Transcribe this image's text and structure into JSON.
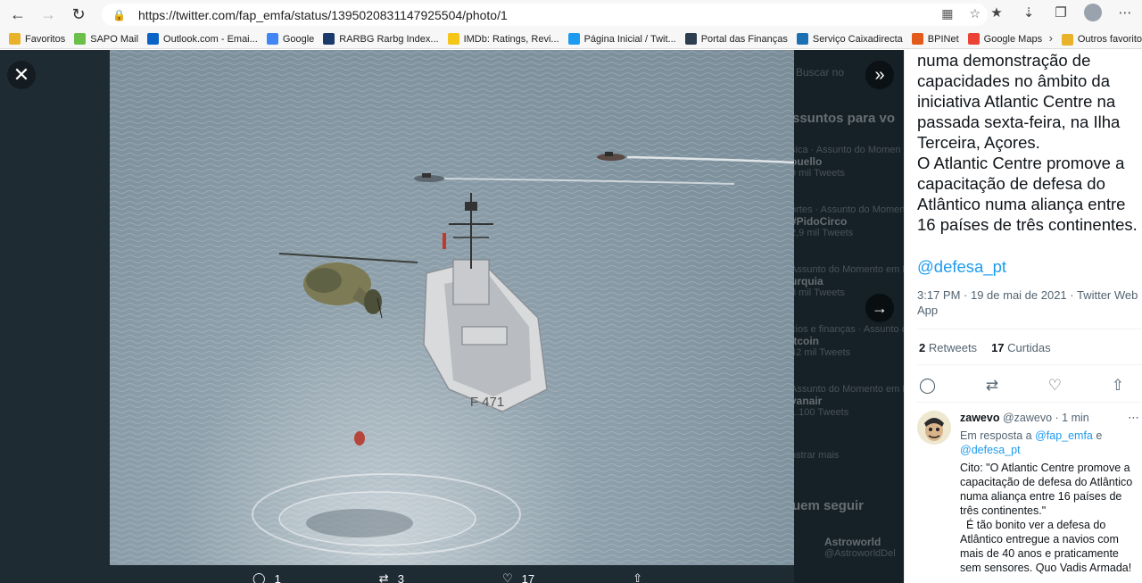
{
  "browser": {
    "url": "https://twitter.com/fap_emfa/status/1395020831147925504/photo/1",
    "bookmarks": [
      {
        "label": "Favoritos",
        "icon": "folder-icon",
        "color": "#e8b32a"
      },
      {
        "label": "SAPO Mail",
        "icon": "sapo-icon",
        "color": "#6cc04a"
      },
      {
        "label": "Outlook.com - Emai...",
        "icon": "outlook-icon",
        "color": "#0a64c8"
      },
      {
        "label": "Google",
        "icon": "google-icon",
        "color": "#4285f4"
      },
      {
        "label": "RARBG Rarbg Index...",
        "icon": "rarbg-icon",
        "color": "#1b3a6b"
      },
      {
        "label": "IMDb: Ratings, Revi...",
        "icon": "imdb-icon",
        "color": "#f5c518"
      },
      {
        "label": "Página Inicial / Twit...",
        "icon": "twitter-icon",
        "color": "#1d9bf0"
      },
      {
        "label": "Portal das Finanças",
        "icon": "financas-icon",
        "color": "#2c3e50"
      },
      {
        "label": "Serviço Caixadirecta",
        "icon": "caixa-icon",
        "color": "#1b6fb3"
      },
      {
        "label": "BPINet",
        "icon": "bpi-icon",
        "color": "#e35a1b"
      },
      {
        "label": "Google Maps",
        "icon": "maps-icon",
        "color": "#ea4335"
      }
    ],
    "other_favorites": "Outros favorito"
  },
  "tweet": {
    "text_lines": [
      "numa demonstração de",
      "capacidades no âmbito da",
      "iniciativa Atlantic Centre na",
      "passada sexta-feira, na Ilha",
      "Terceira, Açores.",
      "O Atlantic Centre promove a",
      "capacitação de defesa do",
      "Atlântico numa aliança entre",
      "16 países de três continentes."
    ],
    "mention": "@defesa_pt",
    "timestamp": "3:17 PM · 19 de mai de 2021 · Twitter Web App",
    "retweets_count": "2",
    "retweets_label": "Retweets",
    "likes_count": "17",
    "likes_label": "Curtidas"
  },
  "media_actions": {
    "replies": "1",
    "retweets": "3",
    "likes": "17"
  },
  "ship_marking": "F 471",
  "ghost": {
    "search": "Buscar no",
    "trends_title": "ssuntos para vo",
    "trends": [
      {
        "meta": "sica · Assunto do Momen",
        "name": "ouello",
        "count": "9 mil Tweets"
      },
      {
        "meta": "ortes · Assunto do Moment",
        "name": "#PidoCirco",
        "count": "2,9 mil Tweets"
      },
      {
        "meta": "Assunto do Momento em Por",
        "name": "urquia",
        "count": "3 mil Tweets"
      },
      {
        "meta": "cios e finanças · Assunto do M",
        "name": "itcoin",
        "count": "42 mil Tweets"
      },
      {
        "meta": "Assunto do Momento em Po",
        "name": "yanair",
        "count": "1.100 Tweets"
      }
    ],
    "show_more": "ostrar mais",
    "follow_title": "uem seguir",
    "follow_name": "Astroworld",
    "follow_handle": "@AstroworldDel"
  },
  "reply": {
    "name": "zawevo",
    "handle": "@zawevo",
    "time": "· 1 min",
    "reply_to_label": "Em resposta a",
    "reply_to_1": "@fap_emfa",
    "reply_to_and": "e",
    "reply_to_2": "@defesa_pt",
    "text": "Cito: \"O Atlantic Centre promove a capacitação de defesa do Atlântico numa aliança entre 16 países de três continentes.\"\n  É tão bonito ver a defesa do Atlântico entregue a navios com mais de 40 anos e praticamente sem sensores. Quo Vadis Armada!"
  }
}
